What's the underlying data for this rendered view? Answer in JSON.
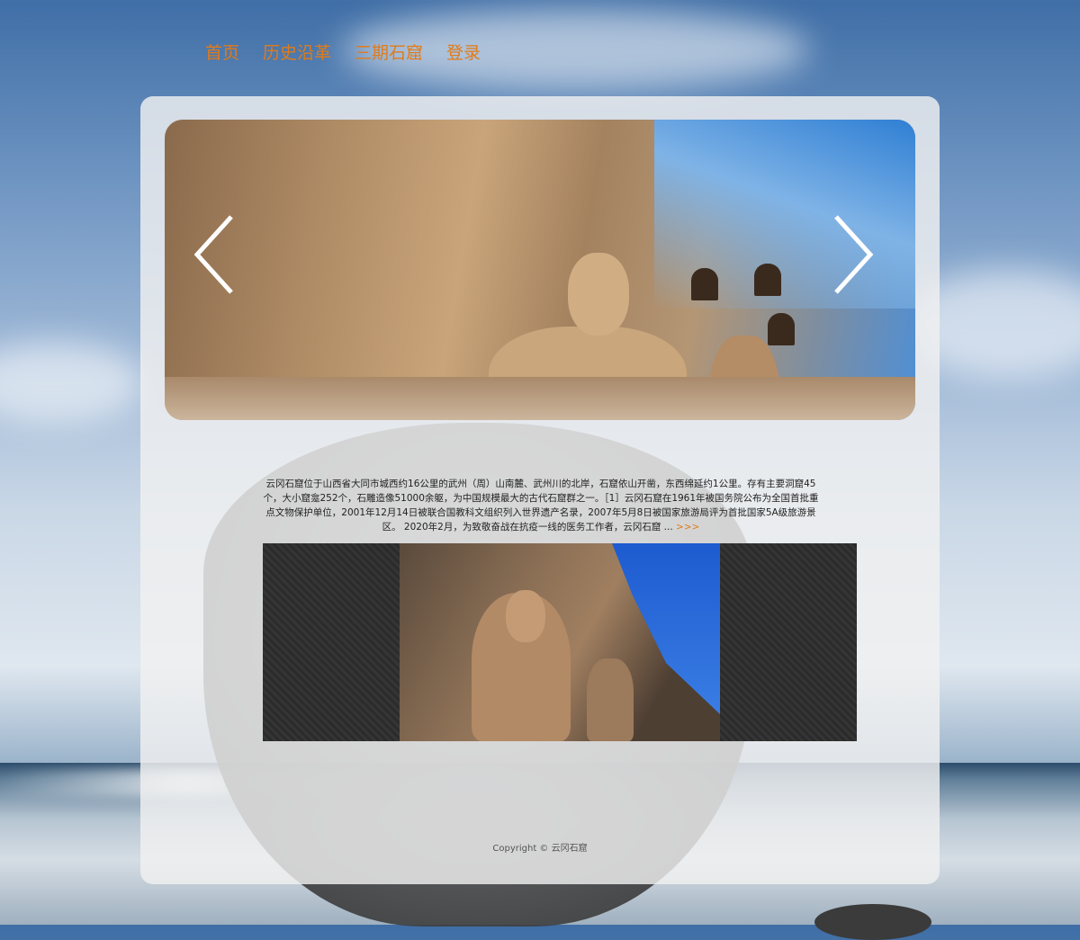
{
  "nav": {
    "items": [
      {
        "label": "首页"
      },
      {
        "label": "历史沿革"
      },
      {
        "label": "三期石窟"
      },
      {
        "label": "登录"
      }
    ]
  },
  "carousel": {
    "prev_icon": "chevron-left-icon",
    "next_icon": "chevron-right-icon"
  },
  "intro": {
    "text": "云冈石窟位于山西省大同市城西约16公里的武州（周）山南麓、武州川的北岸，石窟依山开凿，东西绵延约1公里。存有主要洞窟45个，大小窟龛252个，石雕造像51000余躯，为中国规模最大的古代石窟群之一。［1］云冈石窟在1961年被国务院公布为全国首批重点文物保护单位，2001年12月14日被联合国教科文组织列入世界遗产名录，2007年5月8日被国家旅游局评为首批国家5A级旅游景区。 2020年2月，为致敬奋战在抗疫一线的医务工作者，云冈石窟 ...",
    "more": ">>>"
  },
  "footer": {
    "text": "Copyright © 云冈石窟"
  },
  "colors": {
    "accent": "#e07b1a"
  }
}
